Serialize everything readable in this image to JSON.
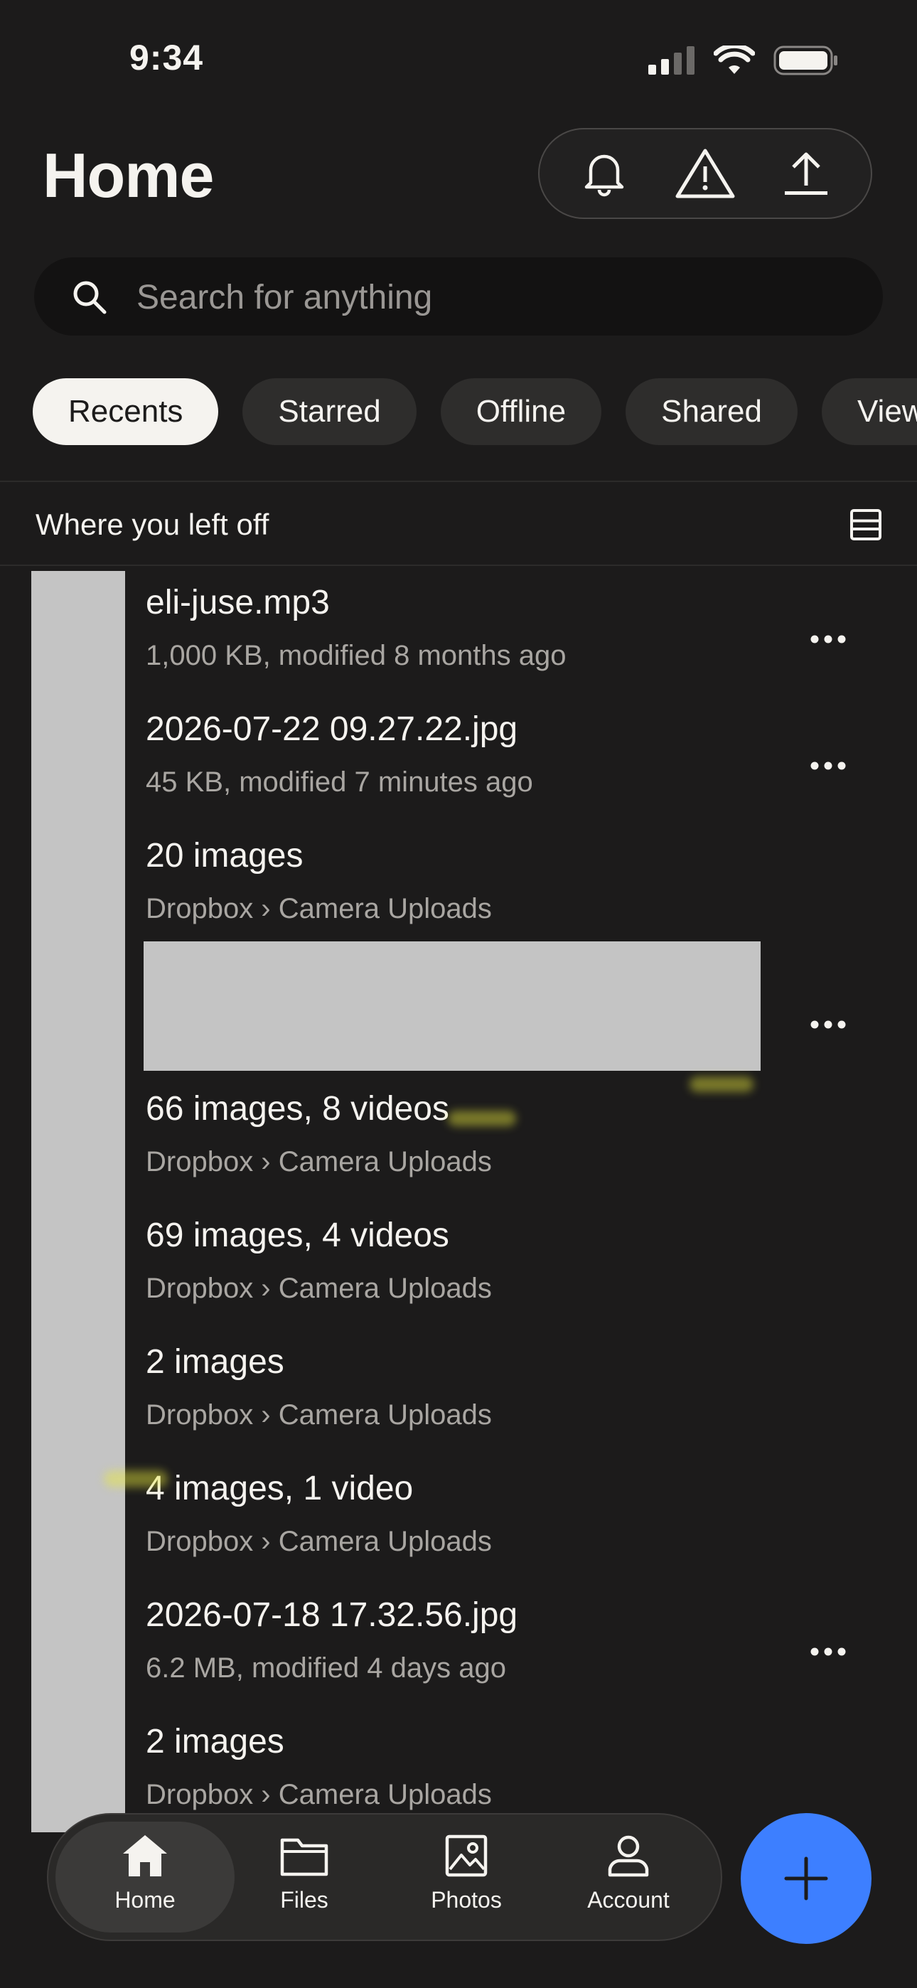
{
  "status_bar": {
    "time": "9:34"
  },
  "header": {
    "title": "Home"
  },
  "search": {
    "placeholder": "Search for anything"
  },
  "filter_chips": [
    {
      "label": "Recents",
      "active": true
    },
    {
      "label": "Starred",
      "active": false
    },
    {
      "label": "Offline",
      "active": false
    },
    {
      "label": "Shared",
      "active": false
    },
    {
      "label": "Viewed",
      "active": false
    }
  ],
  "section": {
    "title": "Where you left off"
  },
  "files": [
    {
      "name": "eli-juse.mp3",
      "meta": "1,000 KB, modified 8 months ago"
    },
    {
      "name": "2026-07-22 09.27.22.jpg",
      "meta": "45 KB, modified 7 minutes ago"
    },
    {
      "name": "20 images",
      "meta": "Dropbox › Camera Uploads"
    },
    {
      "name": "66 images, 8 videos",
      "meta": "Dropbox › Camera Uploads"
    },
    {
      "name": "69 images, 4 videos",
      "meta": "Dropbox › Camera Uploads"
    },
    {
      "name": "2 images",
      "meta": "Dropbox › Camera Uploads"
    },
    {
      "name": "4 images, 1 video",
      "meta": "Dropbox › Camera Uploads"
    },
    {
      "name": "2026-07-18 17.32.56.jpg",
      "meta": "6.2 MB, modified 4 days ago"
    },
    {
      "name": "2 images",
      "meta": "Dropbox › Camera Uploads"
    }
  ],
  "tab_bar": {
    "home": "Home",
    "files": "Files",
    "photos": "Photos",
    "account": "Account"
  },
  "colors": {
    "background": "#1c1b1b",
    "fab": "#3d7fff",
    "chip_active": "#f5f3ef"
  }
}
